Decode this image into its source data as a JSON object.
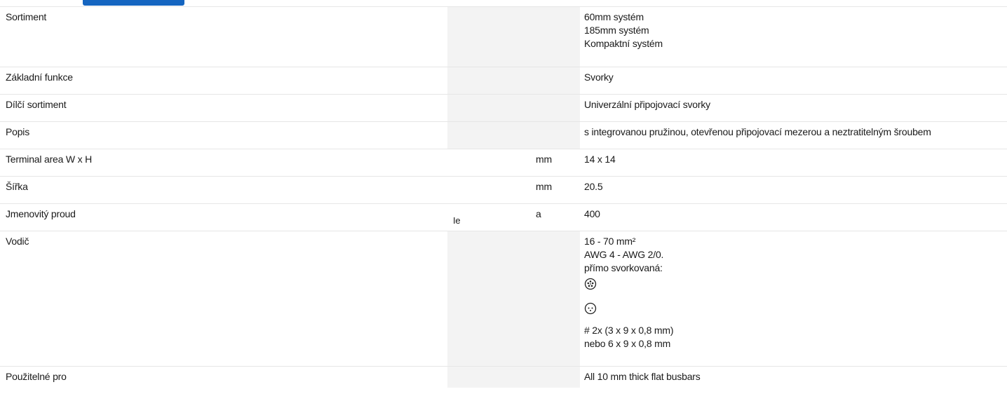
{
  "rows": [
    {
      "label": "Sortiment",
      "symbol": "",
      "unit": "",
      "values": [
        "60mm systém",
        "185mm systém",
        "Kompaktní systém"
      ]
    },
    {
      "label": "Základní funkce",
      "symbol": "",
      "unit": "",
      "values": [
        "Svorky"
      ]
    },
    {
      "label": "Dílčí sortiment",
      "symbol": "",
      "unit": "",
      "values": [
        "Univerzální připojovací svorky"
      ]
    },
    {
      "label": "Popis",
      "symbol": "",
      "unit": "",
      "values": [
        "s integrovanou pružinou, otevřenou připojovací mezerou a neztratitelným šroubem"
      ]
    },
    {
      "label": "Terminal area W x H",
      "symbol": "",
      "unit": "mm",
      "values": [
        "14 x 14"
      ]
    },
    {
      "label": "Šířka",
      "symbol": "",
      "unit": "mm",
      "values": [
        "20.5"
      ]
    },
    {
      "label": "Jmenovitý proud",
      "symbol": "Ie",
      "unit": "a",
      "values": [
        "400"
      ]
    },
    {
      "label": "Vodič",
      "symbol": "",
      "unit": "",
      "values": [
        "16 - 70 mm²",
        "AWG 4 - AWG 2/0.",
        "přímo svorkovaná:"
      ],
      "icons": [
        "stranded-conductor-icon",
        "solid-conductor-icon"
      ],
      "values_after": [
        "# 2x (3 x 9 x 0,8 mm)",
        "nebo 6 x 9 x 0,8 mm"
      ]
    },
    {
      "label": "Použitelné pro",
      "symbol": "",
      "unit": "",
      "values": [
        "All 10 mm thick flat busbars"
      ]
    }
  ],
  "colors": {
    "accent": "#1565c0",
    "symbol_column_bg": "#f3f3f3",
    "row_border": "#e6e6e6"
  }
}
